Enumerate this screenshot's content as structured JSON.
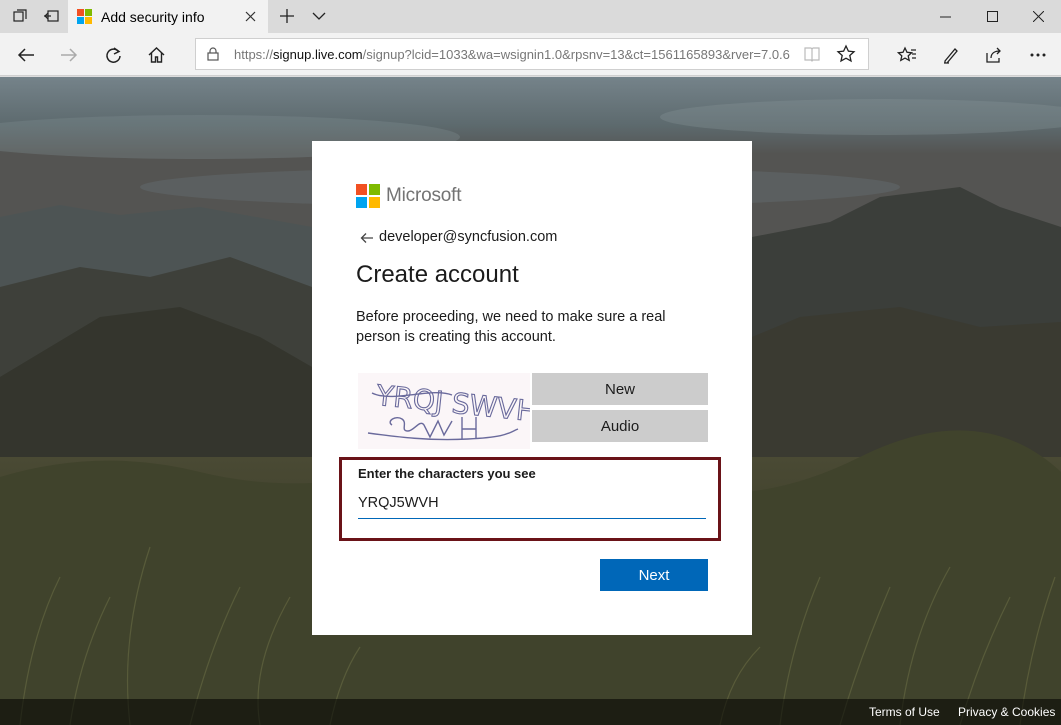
{
  "browser": {
    "tab_title": "Add security info",
    "url_prefix": "https://",
    "url_host": "signup.live.com",
    "url_rest": "/signup?lcid=1033&wa=wsignin1.0&rpsnv=13&ct=1561165893&rver=7.0.6"
  },
  "card": {
    "brand": "Microsoft",
    "identity": "developer@syncfusion.com",
    "heading": "Create account",
    "description": "Before proceeding, we need to make sure a real person is creating this account.",
    "captcha_text": "YRQJ SWVH",
    "new_label": "New",
    "audio_label": "Audio",
    "field_label": "Enter the characters you see",
    "field_value": "YRQJ5WVH",
    "next_label": "Next"
  },
  "footer": {
    "terms": "Terms of Use",
    "privacy": "Privacy & Cookies"
  },
  "colors": {
    "accent": "#0067b8",
    "highlight_border": "#6a1318",
    "ms_red": "#f25022",
    "ms_green": "#7fba00",
    "ms_blue": "#00a4ef",
    "ms_yellow": "#ffb900"
  }
}
